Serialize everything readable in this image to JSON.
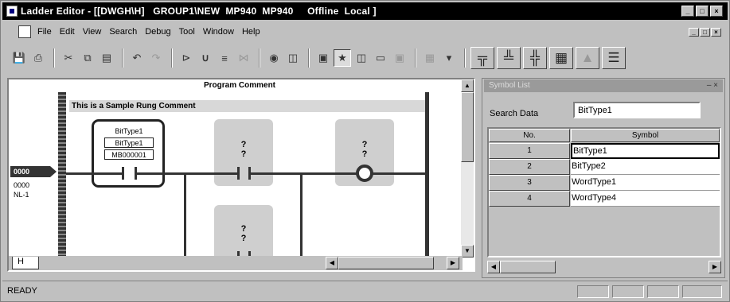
{
  "window": {
    "title": "Ladder Editor - [[DWGH\\H]   GROUP1\\NEW  MP940  MP940     Offline  Local ]",
    "buttons": [
      "_",
      "□",
      "×"
    ]
  },
  "menu": {
    "items": [
      "File",
      "Edit",
      "View",
      "Search",
      "Debug",
      "Tool",
      "Window",
      "Help"
    ],
    "mdi_buttons": [
      "_",
      "□",
      "×"
    ]
  },
  "toolbar": {
    "icons": [
      "save-icon",
      "print-icon",
      "cut-icon",
      "copy-icon",
      "paste-icon",
      "undo-icon",
      "redo-icon",
      "pointer-icon",
      "contact-icon",
      "branch-icon",
      "network-icon",
      "find-icon",
      "monitor-icon",
      "register-icon",
      "star-icon",
      "element-icon",
      "window-icon",
      "dropdown-icon",
      "ladder-view-icon",
      "rung-insert-icon",
      "rung-delete-icon",
      "table-icon",
      "cross-ref-icon",
      "list-icon"
    ]
  },
  "ladder": {
    "program_comment": "Program Comment",
    "rung_comment": "This is a Sample Rung Comment",
    "rung_address": "0000",
    "rung_number": "0000",
    "rung_label": "NL-1",
    "selected_contact": {
      "label1": "BitType1",
      "label2": "BitType1",
      "label3": "MB000001"
    },
    "placeholder_q": "?",
    "tab": "H"
  },
  "panel": {
    "title": "Symbol List",
    "search_label": "Search Data",
    "search_value": "BitType1",
    "columns": [
      "No.",
      "Symbol"
    ],
    "rows": [
      {
        "no": "1",
        "symbol": "BitType1"
      },
      {
        "no": "2",
        "symbol": "BitType2"
      },
      {
        "no": "3",
        "symbol": "WordType1"
      },
      {
        "no": "4",
        "symbol": "WordType4"
      }
    ]
  },
  "status": {
    "text": "READY"
  }
}
